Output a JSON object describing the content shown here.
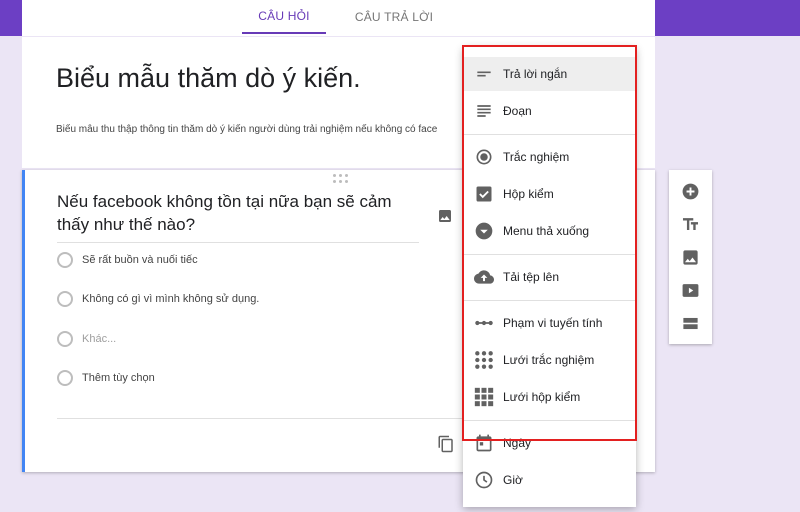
{
  "tabs": {
    "questions": "CÂU HỎI",
    "responses": "CÂU TRẢ LỜI"
  },
  "form": {
    "title": "Biểu mẫu thăm dò ý kiến.",
    "description": "Biểu mẫu thu thập thông tin thăm dò ý kiến người dùng trải nghiệm nếu không có face"
  },
  "question": {
    "text": "Nếu facebook không tồn tại nữa bạn sẽ cảm thấy như thế nào?",
    "options": [
      {
        "label": "Sẽ rất buồn và nuối tiếc"
      },
      {
        "label": "Không có gì vì mình không sử dụng."
      },
      {
        "label": "Khác..."
      },
      {
        "label": "Thêm tùy chọn"
      }
    ]
  },
  "type_menu": {
    "selected": "Trả lời ngắn",
    "items": [
      {
        "label": "Trả lời ngắn",
        "icon": "short-answer-icon"
      },
      {
        "label": "Đoạn",
        "icon": "paragraph-icon"
      },
      {
        "label": "Trắc nghiệm",
        "icon": "radio-icon"
      },
      {
        "label": "Hộp kiểm",
        "icon": "checkbox-icon"
      },
      {
        "label": "Menu thả xuống",
        "icon": "dropdown-icon"
      },
      {
        "label": "Tải tệp lên",
        "icon": "upload-cloud-icon"
      },
      {
        "label": "Phạm vi tuyến tính",
        "icon": "linear-scale-icon"
      },
      {
        "label": "Lưới trắc nghiệm",
        "icon": "grid-dots-icon"
      },
      {
        "label": "Lưới hộp kiểm",
        "icon": "grid-checkbox-icon"
      },
      {
        "label": "Ngày",
        "icon": "calendar-icon"
      },
      {
        "label": "Giờ",
        "icon": "clock-icon"
      }
    ]
  },
  "side_toolbar": [
    "add-question-icon",
    "title-text-icon",
    "image-icon",
    "video-icon",
    "section-icon"
  ],
  "colors": {
    "accent": "#673ab7",
    "header": "#6c3fc4",
    "background": "#ebe5f5",
    "highlight": "#e32020",
    "focus_border": "#4285f4"
  }
}
